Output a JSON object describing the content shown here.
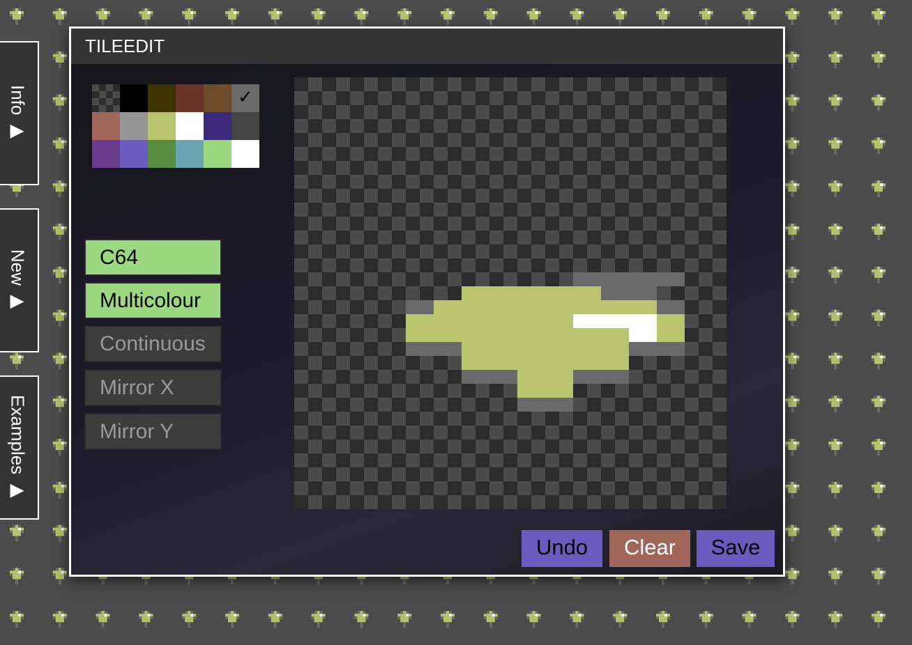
{
  "window": {
    "title": "TILEEDIT"
  },
  "side_tabs": [
    {
      "label": "Info ▶"
    },
    {
      "label": "New ▶"
    },
    {
      "label": "Examples ▶"
    }
  ],
  "palette": {
    "colors": [
      "transparent",
      "#000000",
      "#3d3300",
      "#6a3428",
      "#6e4c28",
      "#6a6a6a",
      "#a0665a",
      "#959595",
      "#b8c56e",
      "#ffffff",
      "#3c297a",
      "#444444",
      "#6d3b8e",
      "#6b5bbf",
      "#568b40",
      "#6da4b1",
      "#9bd87f",
      "#ffffff"
    ],
    "selected_index": 5,
    "check_symbol": "✓"
  },
  "options": {
    "c64": {
      "label": "C64",
      "active": true
    },
    "multicolour": {
      "label": "Multicolour",
      "active": true
    },
    "continuous": {
      "label": "Continuous",
      "active": false
    },
    "mirror_x": {
      "label": "Mirror X",
      "active": false
    },
    "mirror_y": {
      "label": "Mirror Y",
      "active": false
    }
  },
  "actions": {
    "undo": {
      "label": "Undo",
      "color": "#6b5bbf"
    },
    "clear": {
      "label": "Clear",
      "color": "#a0665a"
    },
    "save": {
      "label": "Save",
      "color": "#6b5bbf"
    }
  },
  "tile": {
    "legend": {
      ".": "transparent",
      "G": "#6a6a6a",
      "Y": "#b8c56e",
      "W": "#ffffff"
    },
    "rows": [
      "................",
      "................",
      "................",
      "................",
      "................",
      "................",
      "..........GGGG..",
      "......YYYYYGG...",
      "....GYYYYYYYYG..",
      "....YYYYYYWWWY..",
      "....YYYYYYYYWY..",
      "....GGYYYYYYGG..",
      "......YYYYYY....",
      "......GGYYGG....",
      "........YY......",
      "........GG......"
    ]
  },
  "colors": {
    "accent_green": "#9bd87f",
    "titlebar": "#343434",
    "checker_light": "#4a4a4a",
    "checker_dark": "#2c2c2c"
  }
}
